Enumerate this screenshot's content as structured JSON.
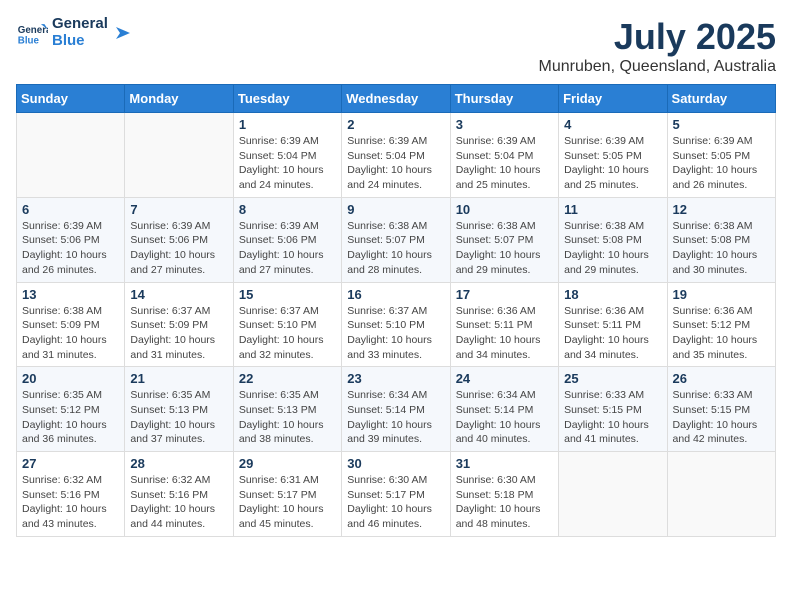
{
  "logo": {
    "line1": "General",
    "line2": "Blue"
  },
  "title": "July 2025",
  "location": "Munruben, Queensland, Australia",
  "days_of_week": [
    "Sunday",
    "Monday",
    "Tuesday",
    "Wednesday",
    "Thursday",
    "Friday",
    "Saturday"
  ],
  "weeks": [
    [
      {
        "day": "",
        "info": ""
      },
      {
        "day": "",
        "info": ""
      },
      {
        "day": "1",
        "info": "Sunrise: 6:39 AM\nSunset: 5:04 PM\nDaylight: 10 hours\nand 24 minutes."
      },
      {
        "day": "2",
        "info": "Sunrise: 6:39 AM\nSunset: 5:04 PM\nDaylight: 10 hours\nand 24 minutes."
      },
      {
        "day": "3",
        "info": "Sunrise: 6:39 AM\nSunset: 5:04 PM\nDaylight: 10 hours\nand 25 minutes."
      },
      {
        "day": "4",
        "info": "Sunrise: 6:39 AM\nSunset: 5:05 PM\nDaylight: 10 hours\nand 25 minutes."
      },
      {
        "day": "5",
        "info": "Sunrise: 6:39 AM\nSunset: 5:05 PM\nDaylight: 10 hours\nand 26 minutes."
      }
    ],
    [
      {
        "day": "6",
        "info": "Sunrise: 6:39 AM\nSunset: 5:06 PM\nDaylight: 10 hours\nand 26 minutes."
      },
      {
        "day": "7",
        "info": "Sunrise: 6:39 AM\nSunset: 5:06 PM\nDaylight: 10 hours\nand 27 minutes."
      },
      {
        "day": "8",
        "info": "Sunrise: 6:39 AM\nSunset: 5:06 PM\nDaylight: 10 hours\nand 27 minutes."
      },
      {
        "day": "9",
        "info": "Sunrise: 6:38 AM\nSunset: 5:07 PM\nDaylight: 10 hours\nand 28 minutes."
      },
      {
        "day": "10",
        "info": "Sunrise: 6:38 AM\nSunset: 5:07 PM\nDaylight: 10 hours\nand 29 minutes."
      },
      {
        "day": "11",
        "info": "Sunrise: 6:38 AM\nSunset: 5:08 PM\nDaylight: 10 hours\nand 29 minutes."
      },
      {
        "day": "12",
        "info": "Sunrise: 6:38 AM\nSunset: 5:08 PM\nDaylight: 10 hours\nand 30 minutes."
      }
    ],
    [
      {
        "day": "13",
        "info": "Sunrise: 6:38 AM\nSunset: 5:09 PM\nDaylight: 10 hours\nand 31 minutes."
      },
      {
        "day": "14",
        "info": "Sunrise: 6:37 AM\nSunset: 5:09 PM\nDaylight: 10 hours\nand 31 minutes."
      },
      {
        "day": "15",
        "info": "Sunrise: 6:37 AM\nSunset: 5:10 PM\nDaylight: 10 hours\nand 32 minutes."
      },
      {
        "day": "16",
        "info": "Sunrise: 6:37 AM\nSunset: 5:10 PM\nDaylight: 10 hours\nand 33 minutes."
      },
      {
        "day": "17",
        "info": "Sunrise: 6:36 AM\nSunset: 5:11 PM\nDaylight: 10 hours\nand 34 minutes."
      },
      {
        "day": "18",
        "info": "Sunrise: 6:36 AM\nSunset: 5:11 PM\nDaylight: 10 hours\nand 34 minutes."
      },
      {
        "day": "19",
        "info": "Sunrise: 6:36 AM\nSunset: 5:12 PM\nDaylight: 10 hours\nand 35 minutes."
      }
    ],
    [
      {
        "day": "20",
        "info": "Sunrise: 6:35 AM\nSunset: 5:12 PM\nDaylight: 10 hours\nand 36 minutes."
      },
      {
        "day": "21",
        "info": "Sunrise: 6:35 AM\nSunset: 5:13 PM\nDaylight: 10 hours\nand 37 minutes."
      },
      {
        "day": "22",
        "info": "Sunrise: 6:35 AM\nSunset: 5:13 PM\nDaylight: 10 hours\nand 38 minutes."
      },
      {
        "day": "23",
        "info": "Sunrise: 6:34 AM\nSunset: 5:14 PM\nDaylight: 10 hours\nand 39 minutes."
      },
      {
        "day": "24",
        "info": "Sunrise: 6:34 AM\nSunset: 5:14 PM\nDaylight: 10 hours\nand 40 minutes."
      },
      {
        "day": "25",
        "info": "Sunrise: 6:33 AM\nSunset: 5:15 PM\nDaylight: 10 hours\nand 41 minutes."
      },
      {
        "day": "26",
        "info": "Sunrise: 6:33 AM\nSunset: 5:15 PM\nDaylight: 10 hours\nand 42 minutes."
      }
    ],
    [
      {
        "day": "27",
        "info": "Sunrise: 6:32 AM\nSunset: 5:16 PM\nDaylight: 10 hours\nand 43 minutes."
      },
      {
        "day": "28",
        "info": "Sunrise: 6:32 AM\nSunset: 5:16 PM\nDaylight: 10 hours\nand 44 minutes."
      },
      {
        "day": "29",
        "info": "Sunrise: 6:31 AM\nSunset: 5:17 PM\nDaylight: 10 hours\nand 45 minutes."
      },
      {
        "day": "30",
        "info": "Sunrise: 6:30 AM\nSunset: 5:17 PM\nDaylight: 10 hours\nand 46 minutes."
      },
      {
        "day": "31",
        "info": "Sunrise: 6:30 AM\nSunset: 5:18 PM\nDaylight: 10 hours\nand 48 minutes."
      },
      {
        "day": "",
        "info": ""
      },
      {
        "day": "",
        "info": ""
      }
    ]
  ]
}
